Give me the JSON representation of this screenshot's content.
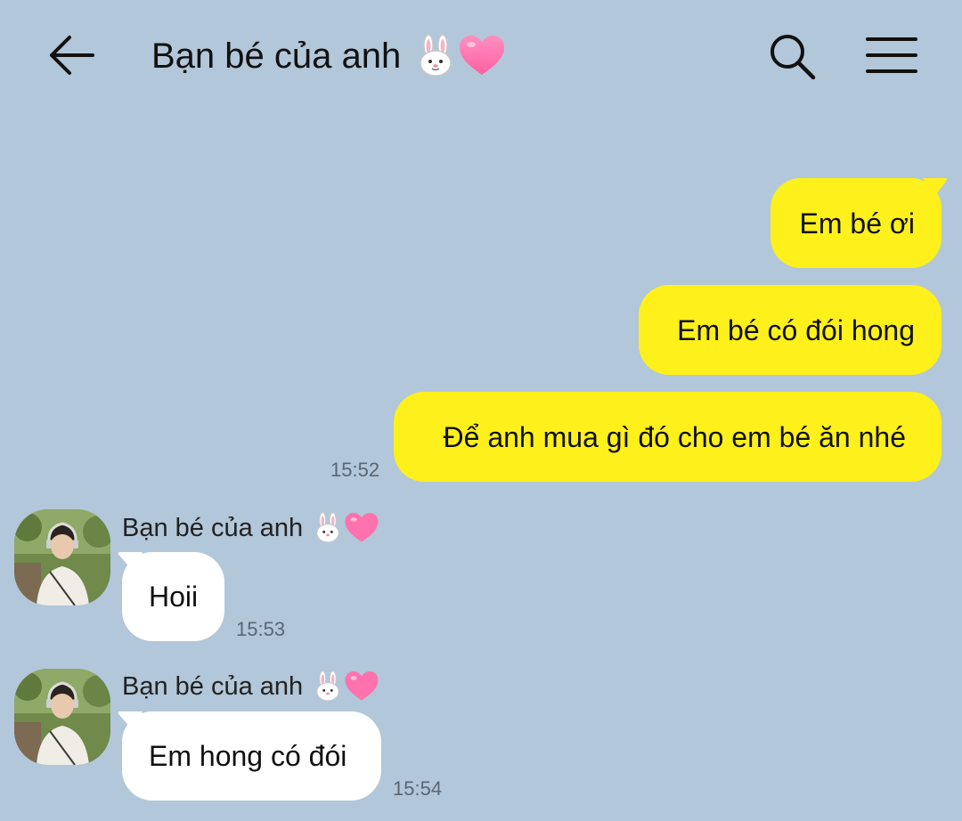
{
  "header": {
    "title": "Bạn bé của anh",
    "title_emojis": [
      "rabbit-face-icon",
      "pink-heart-icon"
    ],
    "back_icon": "arrow-left-icon",
    "search_icon": "search-icon",
    "menu_icon": "hamburger-menu-icon"
  },
  "colors": {
    "background": "#b2c7d9",
    "my_bubble": "#fef01b",
    "their_bubble": "#ffffff",
    "time_text": "#5a6673"
  },
  "messages": {
    "m1": {
      "text": "Em bé ơi"
    },
    "m2": {
      "text": "Em bé có đói hong"
    },
    "m3": {
      "text": "Để anh mua gì đó cho em bé ăn nhé",
      "time": "15:52"
    },
    "m4": {
      "sender": "Bạn bé của anh",
      "text": "Hoii",
      "time": "15:53"
    },
    "m5": {
      "sender": "Bạn bé của anh",
      "text": "Em hong có đói",
      "time": "15:54"
    }
  }
}
